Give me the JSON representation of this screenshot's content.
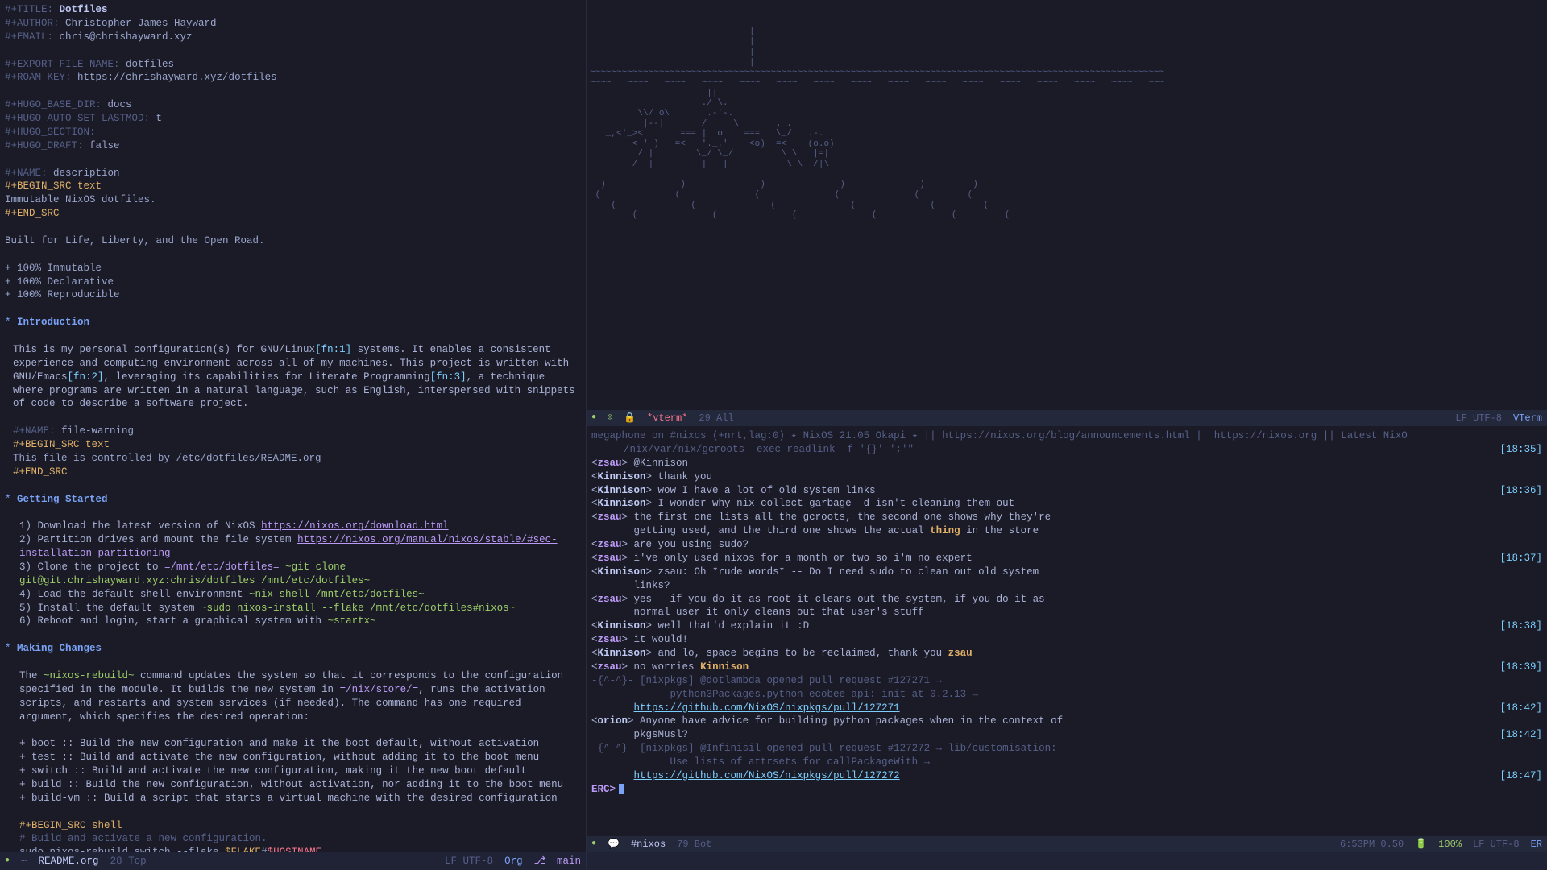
{
  "org": {
    "title_kw": "#+TITLE:",
    "title_val": "Dotfiles",
    "author_kw": "#+AUTHOR:",
    "author_val": "Christopher James Hayward",
    "email_kw": "#+EMAIL:",
    "email_val": "chris@chrishayward.xyz",
    "export_kw": "#+EXPORT_FILE_NAME:",
    "export_val": "dotfiles",
    "roam_kw": "#+ROAM_KEY:",
    "roam_val": "https://chrishayward.xyz/dotfiles",
    "hugo_base_kw": "#+HUGO_BASE_DIR:",
    "hugo_base_val": "docs",
    "hugo_lastmod_kw": "#+HUGO_AUTO_SET_LASTMOD:",
    "hugo_lastmod_val": "t",
    "hugo_section_kw": "#+HUGO_SECTION:",
    "hugo_section_val": "",
    "hugo_draft_kw": "#+HUGO_DRAFT:",
    "hugo_draft_val": "false",
    "name_desc_kw": "#+NAME:",
    "name_desc_val": "description",
    "begin_text": "#+BEGIN_SRC text",
    "desc_body": "Immutable NixOS dotfiles.",
    "end_src": "#+END_SRC",
    "tagline": "Built for Life, Liberty, and the Open Road.",
    "bullet1": "+ 100% Immutable",
    "bullet2": "+ 100% Declarative",
    "bullet3": "+ 100% Reproducible",
    "h_intro": "Introduction",
    "intro_p1a": "This is my personal configuration(s) for GNU/Linux",
    "intro_fn1": "[fn:1]",
    "intro_p1b": " systems. It enables a consistent experience and computing environment across all of my machines. This project is written with GNU/Emacs",
    "intro_fn2": "[fn:2]",
    "intro_p1c": ", leveraging its capabilities for Literate Programming",
    "intro_fn3": "[fn:3]",
    "intro_p1d": ", a technique where programs are written in a natural language, such as English, interspersed with snippets of code to describe a software project.",
    "name_fw_kw": "#+NAME:",
    "name_fw_val": "file-warning",
    "fw_body": "This file is controlled by /etc/dotfiles/README.org",
    "h_getting": "Getting Started",
    "gs_1a": "1) Download the latest version of NixOS ",
    "gs_1_link": "https://nixos.org/download.html",
    "gs_2a": "2) Partition drives and mount the file system ",
    "gs_2_link": "https://nixos.org/manual/nixos/stable/#sec-installation-partitioning",
    "gs_3a": "3) Clone the project to ",
    "gs_3_path": "=/mnt/etc/dotfiles=",
    "gs_3_cmd": " ~git clone git@git.chrishayward.xyz:chris/dotfiles /mnt/etc/dotfiles~",
    "gs_4a": "4) Load the default shell environment ",
    "gs_4_cmd": "~nix-shell /mnt/etc/dotfiles~",
    "gs_5a": "5) Install the default system ",
    "gs_5_cmd": "~sudo nixos-install --flake /mnt/etc/dotfiles#nixos~",
    "gs_6a": "6) Reboot and login, start a graphical system with ",
    "gs_6_cmd": "~startx~",
    "h_changes": "Making Changes",
    "mc_p1a": "The ",
    "mc_cmd": "~nixos-rebuild~",
    "mc_p1b": " command updates the system so that it corresponds to the configuration specified in the module. It builds the new system in ",
    "mc_path": "=/nix/store/=",
    "mc_p1c": ", runs the activation scripts, and restarts and system services (if needed). The command has one required argument, which specifies the desired operation:",
    "mc_b1": "+ boot :: Build the new configuration and make it the boot default, without activation",
    "mc_b2": "+ test :: Build and activate the new configuration, without adding it to the boot menu",
    "mc_b3": "+ switch :: Build and activate the new configuration, making it the new boot default",
    "mc_b4": "+ build :: Build the new configuration, without activation, nor adding it to the boot menu",
    "mc_b5": "+ build-vm :: Build a script that starts a virtual machine with the desired configuration",
    "begin_shell": "#+BEGIN_SRC shell",
    "mc_comment": "# Build and activate a new configuration.",
    "mc_sudo": "sudo nixos-rebuild switch --flake ",
    "mc_flake": "$FLAKE",
    "mc_hash": "#",
    "mc_host": "$HOSTNAME"
  },
  "vt_modeline": {
    "buf": "*vterm*",
    "pos": "29 All",
    "enc": "LF UTF-8",
    "mode": "VTerm"
  },
  "irc_header": {
    "line1a": "megaphone on #nixos (+nrt,lag:0) ",
    "line1b": " NixOS 21.05 Okapi ",
    "line1c": " || https://nixos.org/blog/announcements.html || https://nixos.org || Latest NixO",
    "line2": "/nix/var/nix/gcroots -exec readlink -f '{}' ';'\"",
    "t0": "[18:35]"
  },
  "irc": [
    {
      "nick": "zsau",
      "text": " @Kinnison",
      "time": ""
    },
    {
      "nick": "Kinnison",
      "text": " thank you",
      "time": ""
    },
    {
      "nick": "Kinnison",
      "text": " wow I have a lot of old system links",
      "time": "[18:36]"
    },
    {
      "nick": "Kinnison",
      "text": " I wonder why nix-collect-garbage -d isn't cleaning them out",
      "time": ""
    },
    {
      "nick": "zsau",
      "text": " the first one lists all the gcroots, the second one shows why they're",
      "time": ""
    },
    {
      "nick": "",
      "text": "       getting used, and the third one shows the actual ",
      "kw": "thing",
      "text2": " in the store",
      "time": ""
    },
    {
      "nick": "zsau",
      "text": " are you using sudo?",
      "time": ""
    },
    {
      "nick": "zsau",
      "text": " i've only used nixos for a month or two so i'm no expert",
      "time": "[18:37]"
    },
    {
      "nick": "Kinnison",
      "text": " zsau: Oh *rude words* -- Do I need sudo to clean out old system",
      "time": ""
    },
    {
      "nick": "",
      "text": "       links?",
      "time": ""
    },
    {
      "nick": "zsau",
      "text": " yes - if you do it as root it cleans out the system, if you do it as",
      "time": ""
    },
    {
      "nick": "",
      "text": "       normal user it only cleans out that user's stuff",
      "time": ""
    },
    {
      "nick": "Kinnison",
      "text": " well that'd explain it :D",
      "time": "[18:38]"
    },
    {
      "nick": "zsau",
      "text": " it would!",
      "time": ""
    },
    {
      "nick": "Kinnison",
      "text": " and lo, space begins to be reclaimed, thank you ",
      "kw": "zsau",
      "time": ""
    },
    {
      "nick": "zsau",
      "text": " no worries ",
      "kw": "Kinnison",
      "time": "[18:39]"
    }
  ],
  "irc_bot": [
    {
      "pre": "-{^-^}-",
      "text": " [nixpkgs] @dotlambda opened pull request #127271 →",
      "time": ""
    },
    {
      "pre": "",
      "text": "       python3Packages.python-ecobee-api: init at 0.2.13 →",
      "time": ""
    },
    {
      "pre": "",
      "link": "https://github.com/NixOS/nixpkgs/pull/127271",
      "time": "[18:42]"
    }
  ],
  "irc_orion": {
    "nick": "orion",
    "text": " Anyone have advice for building python packages when in the context of",
    "text2": "       pkgsMusl?",
    "time": "[18:42]"
  },
  "irc_bot2": [
    {
      "pre": "-{^-^}-",
      "text": " [nixpkgs] @Infinisil opened pull request #127272 → lib/customisation:",
      "time": ""
    },
    {
      "pre": "",
      "text": "       Use lists of attrsets for callPackageWith →",
      "time": ""
    },
    {
      "pre": "",
      "link": "https://github.com/NixOS/nixpkgs/pull/127272",
      "time": "[18:47]"
    }
  ],
  "irc_prompt": "ERC>",
  "irc_modeline": {
    "buf": "#nixos",
    "pos": "79 Bot",
    "time": "6:53PM 0.50",
    "batt": "100%",
    "enc": "LF UTF-8",
    "mode": "ER"
  },
  "org_modeline": {
    "buf": "README.org",
    "pos": "28 Top",
    "enc": "LF UTF-8",
    "mode": "Org",
    "branch": "main"
  },
  "ascii": "                              |\n                              |\n                              |\n                              |\n~~~~~~~~~~~~~~~~~~~~~~~~~~~~~~~~~~~~~~~~~~~~~~~~~~~~~~~~~~~~~~~~~~~~~~~~~~~~~~~~~~~~~~~~~~~~~~~~~~~~~~~~~~~~\n~~~~   ~~~~   ~~~~   ~~~~   ~~~~   ~~~~   ~~~~   ~~~~   ~~~~   ~~~~   ~~~~   ~~~~   ~~~~   ~~~~   ~~~~   ~~~\n                      ||           \n                     ./ \\.         \n         \\\\/ o\\       .-'-.         \n          |--|       /     \\       . .\n   _,<'_><       === |  o  | ===   \\_/   .-.\n        < ' )   =<   '._.'    <o)  =<    (o.o)\n         / |        \\_/ \\_/         \\ \\   |=|\n        /  |         |   |           \\ \\  /|\\\n\n  )              )              )              )              )         )\n (              (              (              (              (         (\n    (              (              (              (              (         (\n        (              (              (              (              (         ("
}
